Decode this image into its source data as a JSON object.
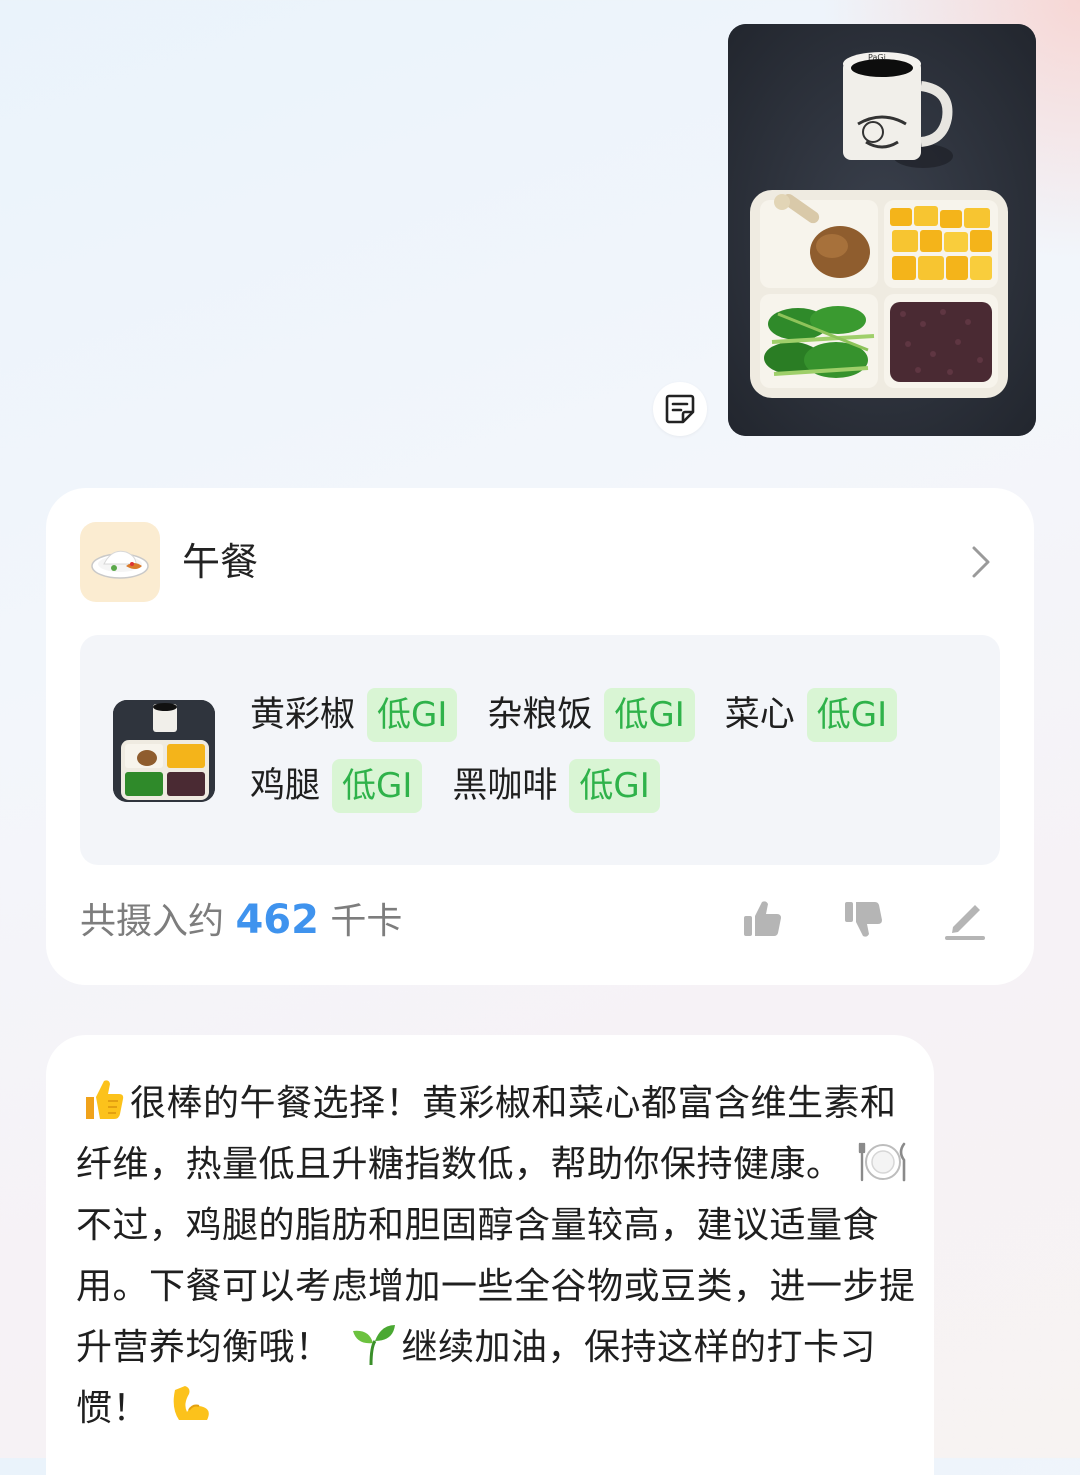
{
  "meal_card": {
    "title": "午餐",
    "icon": "rice-plate-icon",
    "food_rows": [
      [
        {
          "name": "黄彩椒",
          "badge": "低GI"
        },
        {
          "name": "杂粮饭",
          "badge": "低GI"
        },
        {
          "name": "菜心",
          "badge": "低GI"
        }
      ],
      [
        {
          "name": "鸡腿",
          "badge": "低GI"
        },
        {
          "name": "黑咖啡",
          "badge": "低GI"
        }
      ]
    ],
    "total_prefix": "共摄入约",
    "total_kcal": "462",
    "total_unit": "千卡",
    "colors": {
      "kcal": "#3f93ee",
      "badge_bg": "#d9f5d4",
      "badge_text": "#2fb24a"
    }
  },
  "photo": {
    "mug_text": "PaGi"
  },
  "reply": {
    "p1": "很棒的午餐选择！黄彩椒和菜心都富含维生素和纤维，热量低且升糖指数低，帮助你保持健康。",
    "p2": "不过，鸡腿的脂肪和胆固醇含量较高，建议适量食用。下餐可以考虑增加一些全谷物或豆类，进一步提升营养均衡哦！",
    "p3": "继续加油，保持这样的打卡习惯！"
  }
}
